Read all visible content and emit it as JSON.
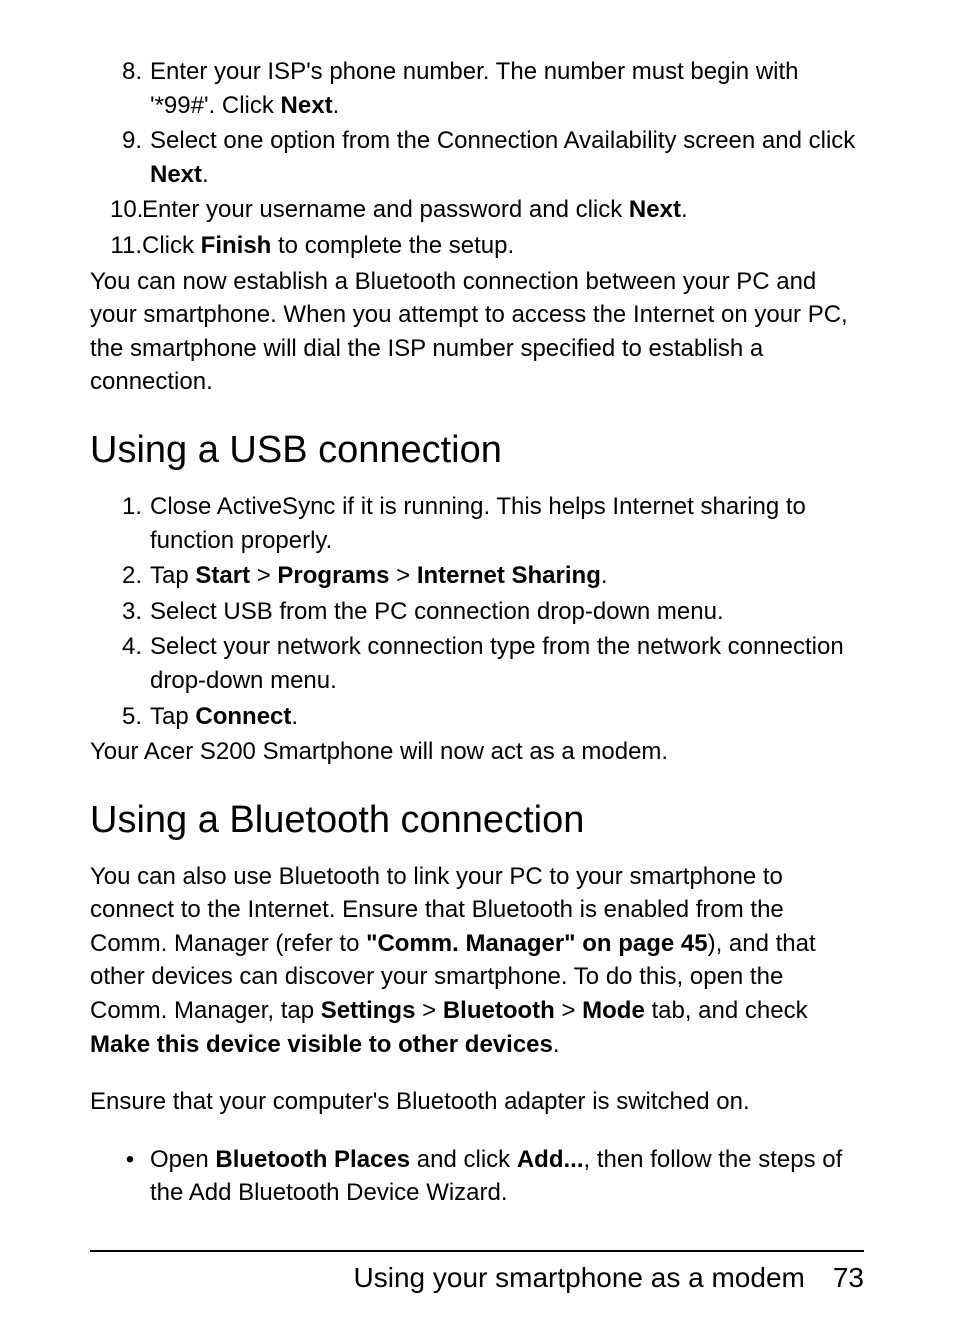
{
  "steps_top": [
    {
      "num": "8.",
      "runs": [
        {
          "t": "Enter your ISP's phone number. The number must begin with '*99#'. Click ",
          "b": false
        },
        {
          "t": "Next",
          "b": true
        },
        {
          "t": ".",
          "b": false
        }
      ]
    },
    {
      "num": "9.",
      "runs": [
        {
          "t": "Select one option from the Connection Availability screen and click ",
          "b": false
        },
        {
          "t": "Next",
          "b": true
        },
        {
          "t": ".",
          "b": false
        }
      ]
    },
    {
      "num": "10.",
      "tight": true,
      "runs": [
        {
          "t": "Enter your username and password and click ",
          "b": false
        },
        {
          "t": "Next",
          "b": true
        },
        {
          "t": ".",
          "b": false
        }
      ]
    },
    {
      "num": "11.",
      "tight": true,
      "runs": [
        {
          "t": "Click ",
          "b": false
        },
        {
          "t": "Finish",
          "b": true
        },
        {
          "t": " to complete the setup.",
          "b": false
        }
      ]
    }
  ],
  "para_after_top": "You can now establish a Bluetooth connection between your PC and your smartphone. When you attempt to access the Internet on your PC, the smartphone will dial the ISP number specified to establish a connection.",
  "heading_usb": "Using a USB connection",
  "steps_usb": [
    {
      "num": "1.",
      "runs": [
        {
          "t": "Close ActiveSync if it is running. This helps Internet sharing to function properly.",
          "b": false
        }
      ]
    },
    {
      "num": "2.",
      "runs": [
        {
          "t": "Tap ",
          "b": false
        },
        {
          "t": "Start",
          "b": true
        },
        {
          "t": " > ",
          "b": false
        },
        {
          "t": "Programs",
          "b": true
        },
        {
          "t": " > ",
          "b": false
        },
        {
          "t": "Internet Sharing",
          "b": true
        },
        {
          "t": ".",
          "b": false
        }
      ]
    },
    {
      "num": "3.",
      "runs": [
        {
          "t": "Select USB from the PC connection drop-down menu.",
          "b": false
        }
      ]
    },
    {
      "num": "4.",
      "runs": [
        {
          "t": "Select your network connection type from the network connection drop-down menu.",
          "b": false
        }
      ]
    },
    {
      "num": "5.",
      "runs": [
        {
          "t": "Tap ",
          "b": false
        },
        {
          "t": "Connect",
          "b": true
        },
        {
          "t": ".",
          "b": false
        }
      ]
    }
  ],
  "para_after_usb": "Your Acer S200 Smartphone will now act as a modem.",
  "heading_bt": "Using a Bluetooth connection",
  "para_bt_runs": [
    {
      "t": "You can also use Bluetooth to link your PC to your smartphone to connect to the Internet. Ensure that Bluetooth is enabled from the Comm. Manager (refer to ",
      "b": false
    },
    {
      "t": "\"Comm. Manager\" on page 45",
      "b": true
    },
    {
      "t": "), and that other devices can discover your smartphone. To do this, open the Comm. Manager, tap ",
      "b": false
    },
    {
      "t": "Settings",
      "b": true
    },
    {
      "t": " > ",
      "b": false
    },
    {
      "t": "Bluetooth ",
      "b": true
    },
    {
      "t": " > ",
      "b": false
    },
    {
      "t": "Mode",
      "b": true
    },
    {
      "t": " tab, and check ",
      "b": false
    },
    {
      "t": "Make this device visible to other devices",
      "b": true
    },
    {
      "t": ".",
      "b": false
    }
  ],
  "para_bt2": "Ensure that your computer's Bluetooth adapter is switched on.",
  "bullet_bt_runs": [
    {
      "t": "Open ",
      "b": false
    },
    {
      "t": "Bluetooth Places",
      "b": true
    },
    {
      "t": " and click ",
      "b": false
    },
    {
      "t": "Add...",
      "b": true
    },
    {
      "t": ", then follow the steps of the Add Bluetooth Device Wizard.",
      "b": false
    }
  ],
  "footer_title": "Using your smartphone as a modem",
  "footer_page": "73"
}
